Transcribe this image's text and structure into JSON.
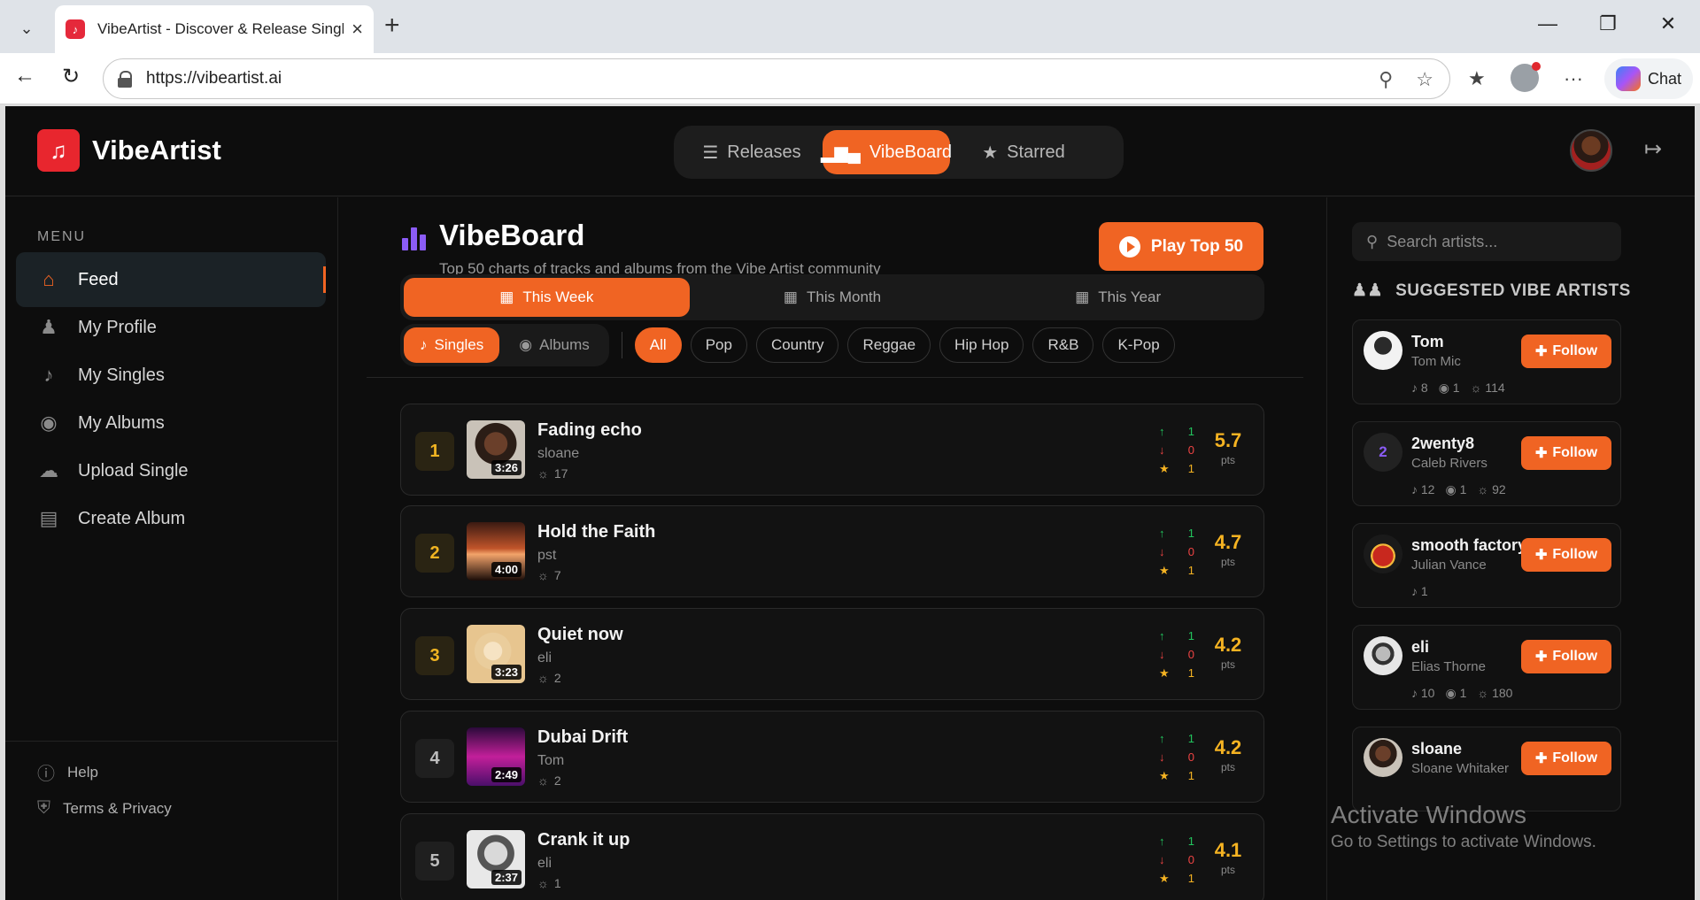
{
  "browser": {
    "tab_title": "VibeArtist - Discover & Release Singles",
    "url": "https://vibeartist.ai",
    "chat_label": "Chat"
  },
  "app": {
    "brand": "VibeArtist",
    "topnav": [
      {
        "label": "Releases",
        "icon": "list-music-icon",
        "active": false
      },
      {
        "label": "VibeBoard",
        "icon": "bar-chart-icon",
        "active": true
      },
      {
        "label": "Starred",
        "icon": "star-icon",
        "active": false
      }
    ]
  },
  "sidebar": {
    "menu_label": "MENU",
    "items": [
      {
        "label": "Feed",
        "icon": "home-icon",
        "active": true
      },
      {
        "label": "My Profile",
        "icon": "user-icon"
      },
      {
        "label": "My Singles",
        "icon": "music-note-icon"
      },
      {
        "label": "My Albums",
        "icon": "disc-icon"
      },
      {
        "label": "Upload Single",
        "icon": "cloud-upload-icon"
      },
      {
        "label": "Create Album",
        "icon": "album-add-icon"
      }
    ],
    "footer": [
      {
        "label": "Help",
        "icon": "help-icon"
      },
      {
        "label": "Terms & Privacy",
        "icon": "shield-icon"
      }
    ]
  },
  "vibeboard": {
    "title": "VibeBoard",
    "subtitle": "Top 50 charts of tracks and albums from the Vibe Artist community",
    "play_button": "Play Top 50",
    "periods": [
      {
        "label": "This Week",
        "active": true
      },
      {
        "label": "This Month",
        "active": false
      },
      {
        "label": "This Year",
        "active": false
      }
    ],
    "kinds": [
      {
        "label": "Singles",
        "active": true
      },
      {
        "label": "Albums",
        "active": false
      }
    ],
    "genres": [
      "All",
      "Pop",
      "Country",
      "Reggae",
      "Hip Hop",
      "R&B",
      "K-Pop"
    ],
    "active_genre": "All",
    "tracks": [
      {
        "rank": "1",
        "title": "Fading echo",
        "artist": "sloane",
        "plays": "17",
        "duration": "3:26",
        "up": "1",
        "down": "0",
        "stars": "1",
        "points": "5.7",
        "points_label": "pts"
      },
      {
        "rank": "2",
        "title": "Hold the Faith",
        "artist": "pst",
        "plays": "7",
        "duration": "4:00",
        "up": "1",
        "down": "0",
        "stars": "1",
        "points": "4.7",
        "points_label": "pts"
      },
      {
        "rank": "3",
        "title": "Quiet now",
        "artist": "eli",
        "plays": "2",
        "duration": "3:23",
        "up": "1",
        "down": "0",
        "stars": "1",
        "points": "4.2",
        "points_label": "pts"
      },
      {
        "rank": "4",
        "title": "Dubai Drift",
        "artist": "Tom",
        "plays": "2",
        "duration": "2:49",
        "up": "1",
        "down": "0",
        "stars": "1",
        "points": "4.2",
        "points_label": "pts"
      },
      {
        "rank": "5",
        "title": "Crank it up",
        "artist": "eli",
        "plays": "1",
        "duration": "2:37",
        "up": "1",
        "down": "0",
        "stars": "1",
        "points": "4.1",
        "points_label": "pts"
      }
    ]
  },
  "suggested": {
    "search_placeholder": "Search artists...",
    "heading": "SUGGESTED VIBE ARTISTS",
    "follow_label": "Follow",
    "artists": [
      {
        "name": "Tom",
        "sub": "Tom Mic",
        "singles": "8",
        "albums": "1",
        "plays": "114",
        "initial": ""
      },
      {
        "name": "2wenty8",
        "sub": "Caleb Rivers",
        "singles": "12",
        "albums": "1",
        "plays": "92",
        "initial": "2"
      },
      {
        "name": "smooth factory",
        "sub": "Julian Vance",
        "singles": "1",
        "albums": "",
        "plays": "",
        "initial": ""
      },
      {
        "name": "eli",
        "sub": "Elias Thorne",
        "singles": "10",
        "albums": "1",
        "plays": "180",
        "initial": ""
      },
      {
        "name": "sloane",
        "sub": "Sloane Whitaker",
        "singles": "",
        "albums": "",
        "plays": "",
        "initial": ""
      }
    ]
  },
  "watermark": {
    "line1": "Activate Windows",
    "line2": "Go to Settings to activate Windows."
  },
  "colors": {
    "accent": "#f06423",
    "gold": "#f5b322",
    "purple": "#8b5cf6"
  }
}
